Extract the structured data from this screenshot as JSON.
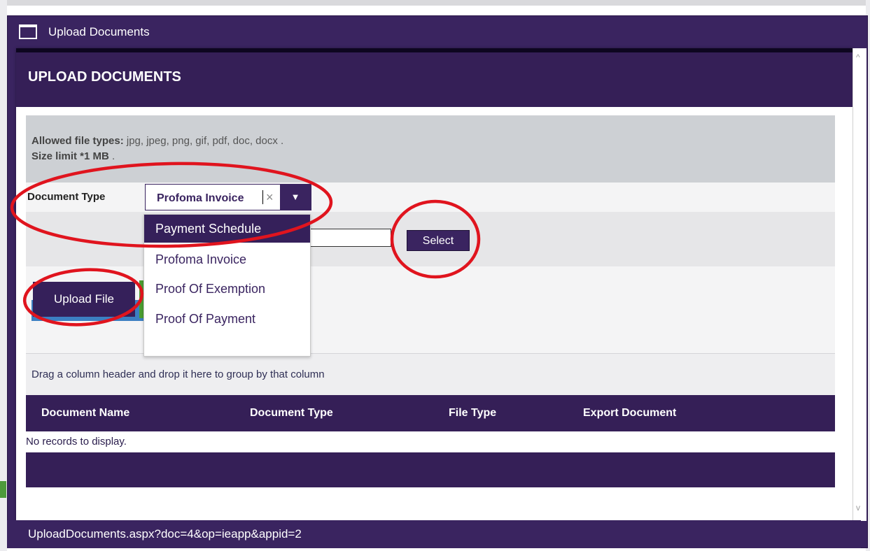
{
  "window": {
    "title": "Upload Documents"
  },
  "header": {
    "title": "UPLOAD DOCUMENTS"
  },
  "info": {
    "types_label": "Allowed file types:",
    "types_value": " jpg, jpeg, png, gif, pdf, doc, docx .",
    "size_label": "Size limit *1 MB",
    "size_value": " ."
  },
  "form": {
    "doc_type_label": "Document Type",
    "doc_type_value": "Profoma Invoice",
    "clear_glyph": "×",
    "arrow_glyph": "▼",
    "select_label": "Select",
    "upload_label": "Upload File"
  },
  "dropdown": {
    "options": [
      "Payment Schedule",
      "Profoma Invoice",
      "Proof Of Exemption",
      "Proof Of Payment"
    ],
    "highlighted": "Payment Schedule"
  },
  "grid": {
    "group_hint": "Drag a column header and drop it here to group by that column",
    "columns": [
      "Document Name",
      "Document Type",
      "File Type",
      "Export Document"
    ],
    "empty_text": "No records to display."
  },
  "scroll": {
    "up_glyph": "^",
    "down_glyph": "v"
  },
  "status": {
    "url": "UploadDocuments.aspx?doc=4&op=ieapp&appid=2"
  },
  "colors": {
    "primary": "#3a2460",
    "annotation": "#e0141e",
    "info_bg": "#cdd0d4"
  },
  "icons": {
    "window": "window-icon",
    "clear": "clear-x-icon",
    "arrow": "dropdown-arrow-icon"
  }
}
